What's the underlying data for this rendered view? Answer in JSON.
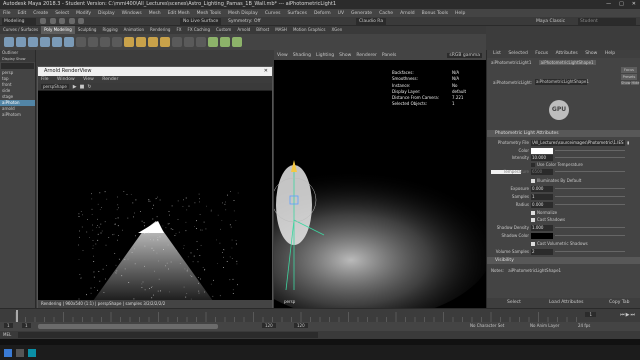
{
  "window": {
    "title": "Autodesk Maya 2018.3 - Student Version: C:\\mmi400\\All_Lectures\\scenes\\Astro_Lighting_Pamas_1B_Wall.mb*  ---  aiPhotometricLight1"
  },
  "menubar": {
    "items": [
      "File",
      "Edit",
      "Create",
      "Select",
      "Modify",
      "Display",
      "Windows",
      "Mesh",
      "Edit Mesh",
      "Mesh Tools",
      "Mesh Display",
      "Curves",
      "Surfaces",
      "Deform",
      "UV",
      "Generate",
      "Cache",
      "Arnold",
      "Bonus Tools",
      "Help"
    ]
  },
  "statusline": {
    "mode": "Modeling",
    "symmetry": "Symmetry: Off",
    "live_surface": "No Live Surface",
    "workspace": "Claudio Ra",
    "search_placeholder": "Student",
    "user": "Maya Classic"
  },
  "shelf_tabs": [
    "Curves / Surfaces",
    "Poly Modeling",
    "Sculpting",
    "Rigging",
    "Animation",
    "Rendering",
    "FX",
    "FX Caching",
    "Custom",
    "Arnold",
    "Bifrost",
    "MASH",
    "Motion Graphics",
    "XGen"
  ],
  "outliner": {
    "title": "Outliner",
    "menu": [
      "Display",
      "Show",
      "Help"
    ],
    "items": [
      "persp",
      "top",
      "front",
      "side",
      "stage",
      "aiPhoton",
      "arnold",
      "aiPhotom"
    ]
  },
  "arnold_rv": {
    "title": "Arnold RenderView",
    "menu": [
      "File",
      "Window",
      "View",
      "Render"
    ],
    "camera": "perspShape",
    "status": "Rendering | 960x540 (1:1) | perspShape | samples 3/2/2/2/2/2"
  },
  "viewport": {
    "menu": [
      "View",
      "Shading",
      "Lighting",
      "Show",
      "Renderer",
      "Panels"
    ],
    "camera_label": "persp",
    "color_space": "sRGB gamma",
    "hud": [
      {
        "label": "Backfaces:",
        "value": "N/A"
      },
      {
        "label": "Smoothness:",
        "value": "N/A"
      },
      {
        "label": "Instance:",
        "value": "No"
      },
      {
        "label": "Display Layer:",
        "value": "default"
      },
      {
        "label": "Distance From Camera:",
        "value": "7.221"
      },
      {
        "label": "Selected Objects:",
        "value": "1"
      }
    ]
  },
  "attribute_editor": {
    "tabs": [
      "List",
      "Selected",
      "Focus",
      "Attributes",
      "Show",
      "Help"
    ],
    "node_tabs": [
      "aiPhotometricLight1",
      "aiPhotometricLightShape1"
    ],
    "shape_label": "aiPhotometricLight:",
    "shape_value": "aiPhotometricLightShape1",
    "buttons": [
      "Focus",
      "Presets",
      "Show",
      "Hide"
    ],
    "section_title": "Photometric Light Attributes",
    "photometry_file_label": "Photometry File",
    "photometry_file": "\\All_Lectures\\sourceimages\\Photometric\\1.IES",
    "color_label": "Color",
    "intensity_label": "Intensity",
    "intensity_value": "10.000",
    "use_color_temp": "Use Color Temperature",
    "temperature_label": "Temperature",
    "temperature_value": "6500",
    "illuminates_default": "Illuminates By Default",
    "exposure_label": "Exposure",
    "exposure_value": "0.000",
    "samples_label": "Samples",
    "samples_value": "1",
    "radius_label": "Radius",
    "radius_value": "0.000",
    "normalize": "Normalize",
    "cast_shadows": "Cast Shadows",
    "shadow_density_label": "Shadow Density",
    "shadow_density_value": "1.000",
    "shadow_color_label": "Shadow Color",
    "cast_volumetric": "Cast Volumetric Shadows",
    "volume_samples_label": "Volume Samples",
    "volume_samples_value": "2",
    "visibility_section": "Visibility",
    "notes_label": "Notes:",
    "notes_value": "aiPhotometricLightShape1",
    "footer": [
      "Select",
      "Load Attributes",
      "Copy Tab"
    ]
  },
  "timeline": {
    "start": "1",
    "end": "120",
    "range_start": "1",
    "range_end": "120",
    "current": "1",
    "character_set": "No Character Set",
    "anim_layer": "No Anim Layer",
    "fps": "24 fps"
  },
  "cmdline": {
    "label": "MEL"
  },
  "colors": {
    "selection": "#5285a6",
    "panel": "#444444",
    "viewport_bg": "#000000"
  }
}
